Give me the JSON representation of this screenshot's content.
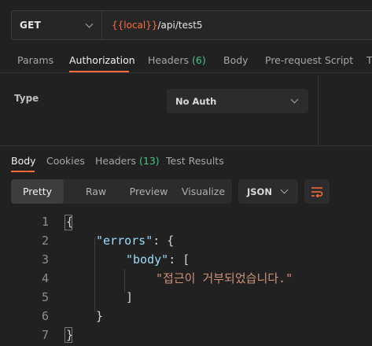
{
  "request": {
    "method": "GET",
    "url_var": "{{local}}",
    "url_path": "/api/test5"
  },
  "request_tabs": [
    {
      "label": "Params"
    },
    {
      "label": "Authorization",
      "active": true
    },
    {
      "label": "Headers",
      "count": "(6)"
    },
    {
      "label": "Body"
    },
    {
      "label": "Pre-request Script"
    },
    {
      "label": "T"
    }
  ],
  "auth": {
    "type_label": "Type",
    "type_value": "No Auth"
  },
  "response_tabs": [
    {
      "label": "Body",
      "active": true
    },
    {
      "label": "Cookies"
    },
    {
      "label": "Headers",
      "count": "(13)"
    },
    {
      "label": "Test Results"
    }
  ],
  "view_modes": [
    {
      "label": "Pretty",
      "active": true
    },
    {
      "label": "Raw"
    },
    {
      "label": "Preview"
    },
    {
      "label": "Visualize"
    }
  ],
  "format": "JSON",
  "icons": {
    "method_dropdown": "chevron-down-icon",
    "wrap": "wrap-lines-icon"
  },
  "colors": {
    "accent": "#ff6c37",
    "count": "#49c785",
    "json_key": "#9cdcfe",
    "json_string": "#ce9178"
  },
  "code": {
    "line_numbers": [
      "1",
      "2",
      "3",
      "4",
      "5",
      "6",
      "7"
    ],
    "l1": "{",
    "l2_key": "\"errors\"",
    "l2_rest": ": {",
    "l3_key": "\"body\"",
    "l3_rest": ": [",
    "l4_str": "\"접근이 거부되었습니다.\"",
    "l5": "]",
    "l6": "}",
    "l7": "}"
  }
}
